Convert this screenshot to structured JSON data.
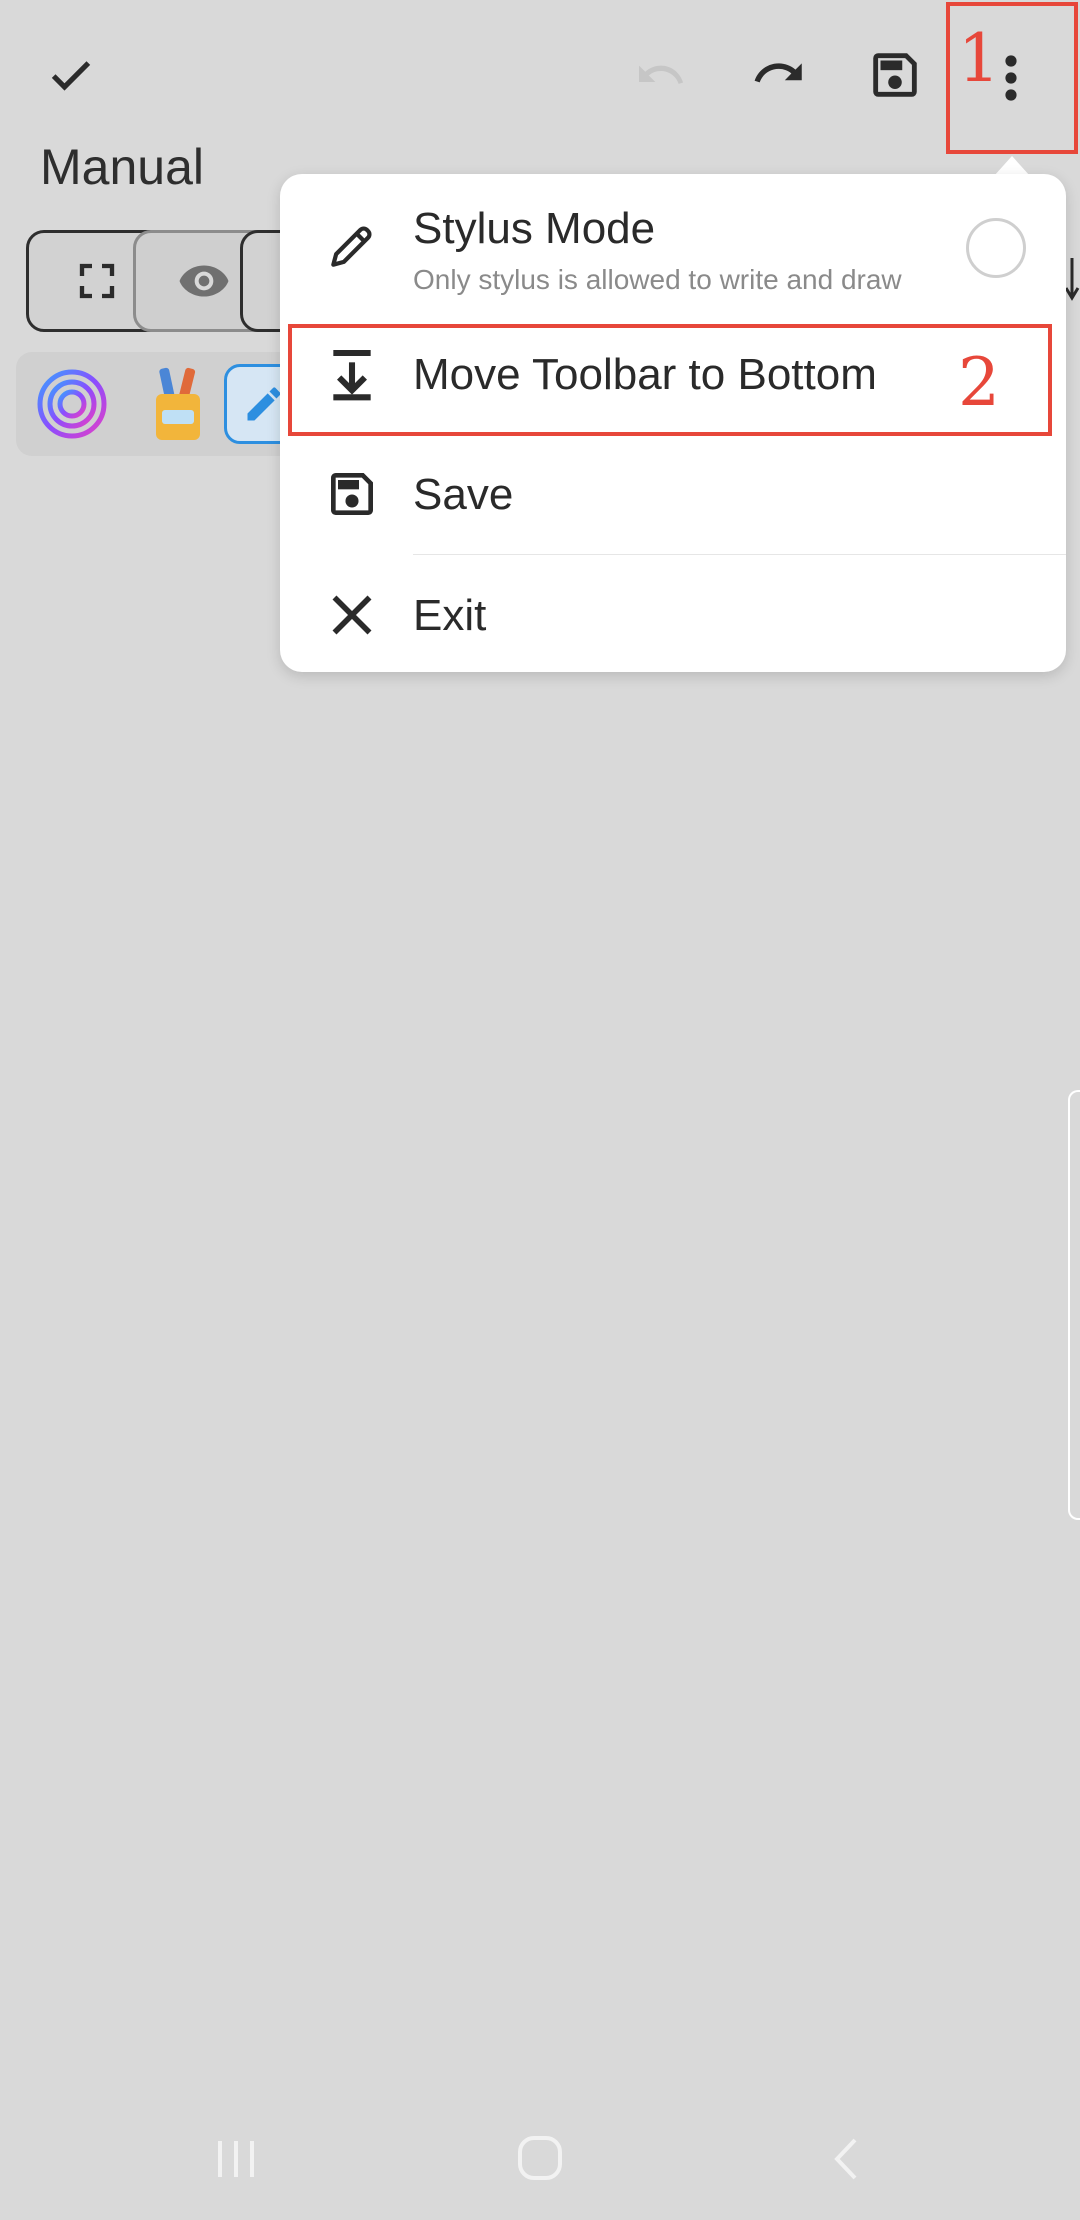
{
  "header": {
    "title": "Manual"
  },
  "menu": {
    "items": [
      {
        "label": "Stylus Mode",
        "subtitle": "Only stylus is allowed to write and draw",
        "icon": "pencil-icon",
        "toggle_checked": false
      },
      {
        "label": "Move Toolbar to Bottom",
        "icon": "move-to-bottom-icon"
      },
      {
        "label": "Save",
        "icon": "save-icon"
      },
      {
        "label": "Exit",
        "icon": "close-icon"
      }
    ]
  },
  "annotations": {
    "step1": "1",
    "step2": "2",
    "color": "#e7473a"
  },
  "colors": {
    "background": "#d9d9d9",
    "menu_background": "#ffffff",
    "highlight": "#e7473a"
  }
}
